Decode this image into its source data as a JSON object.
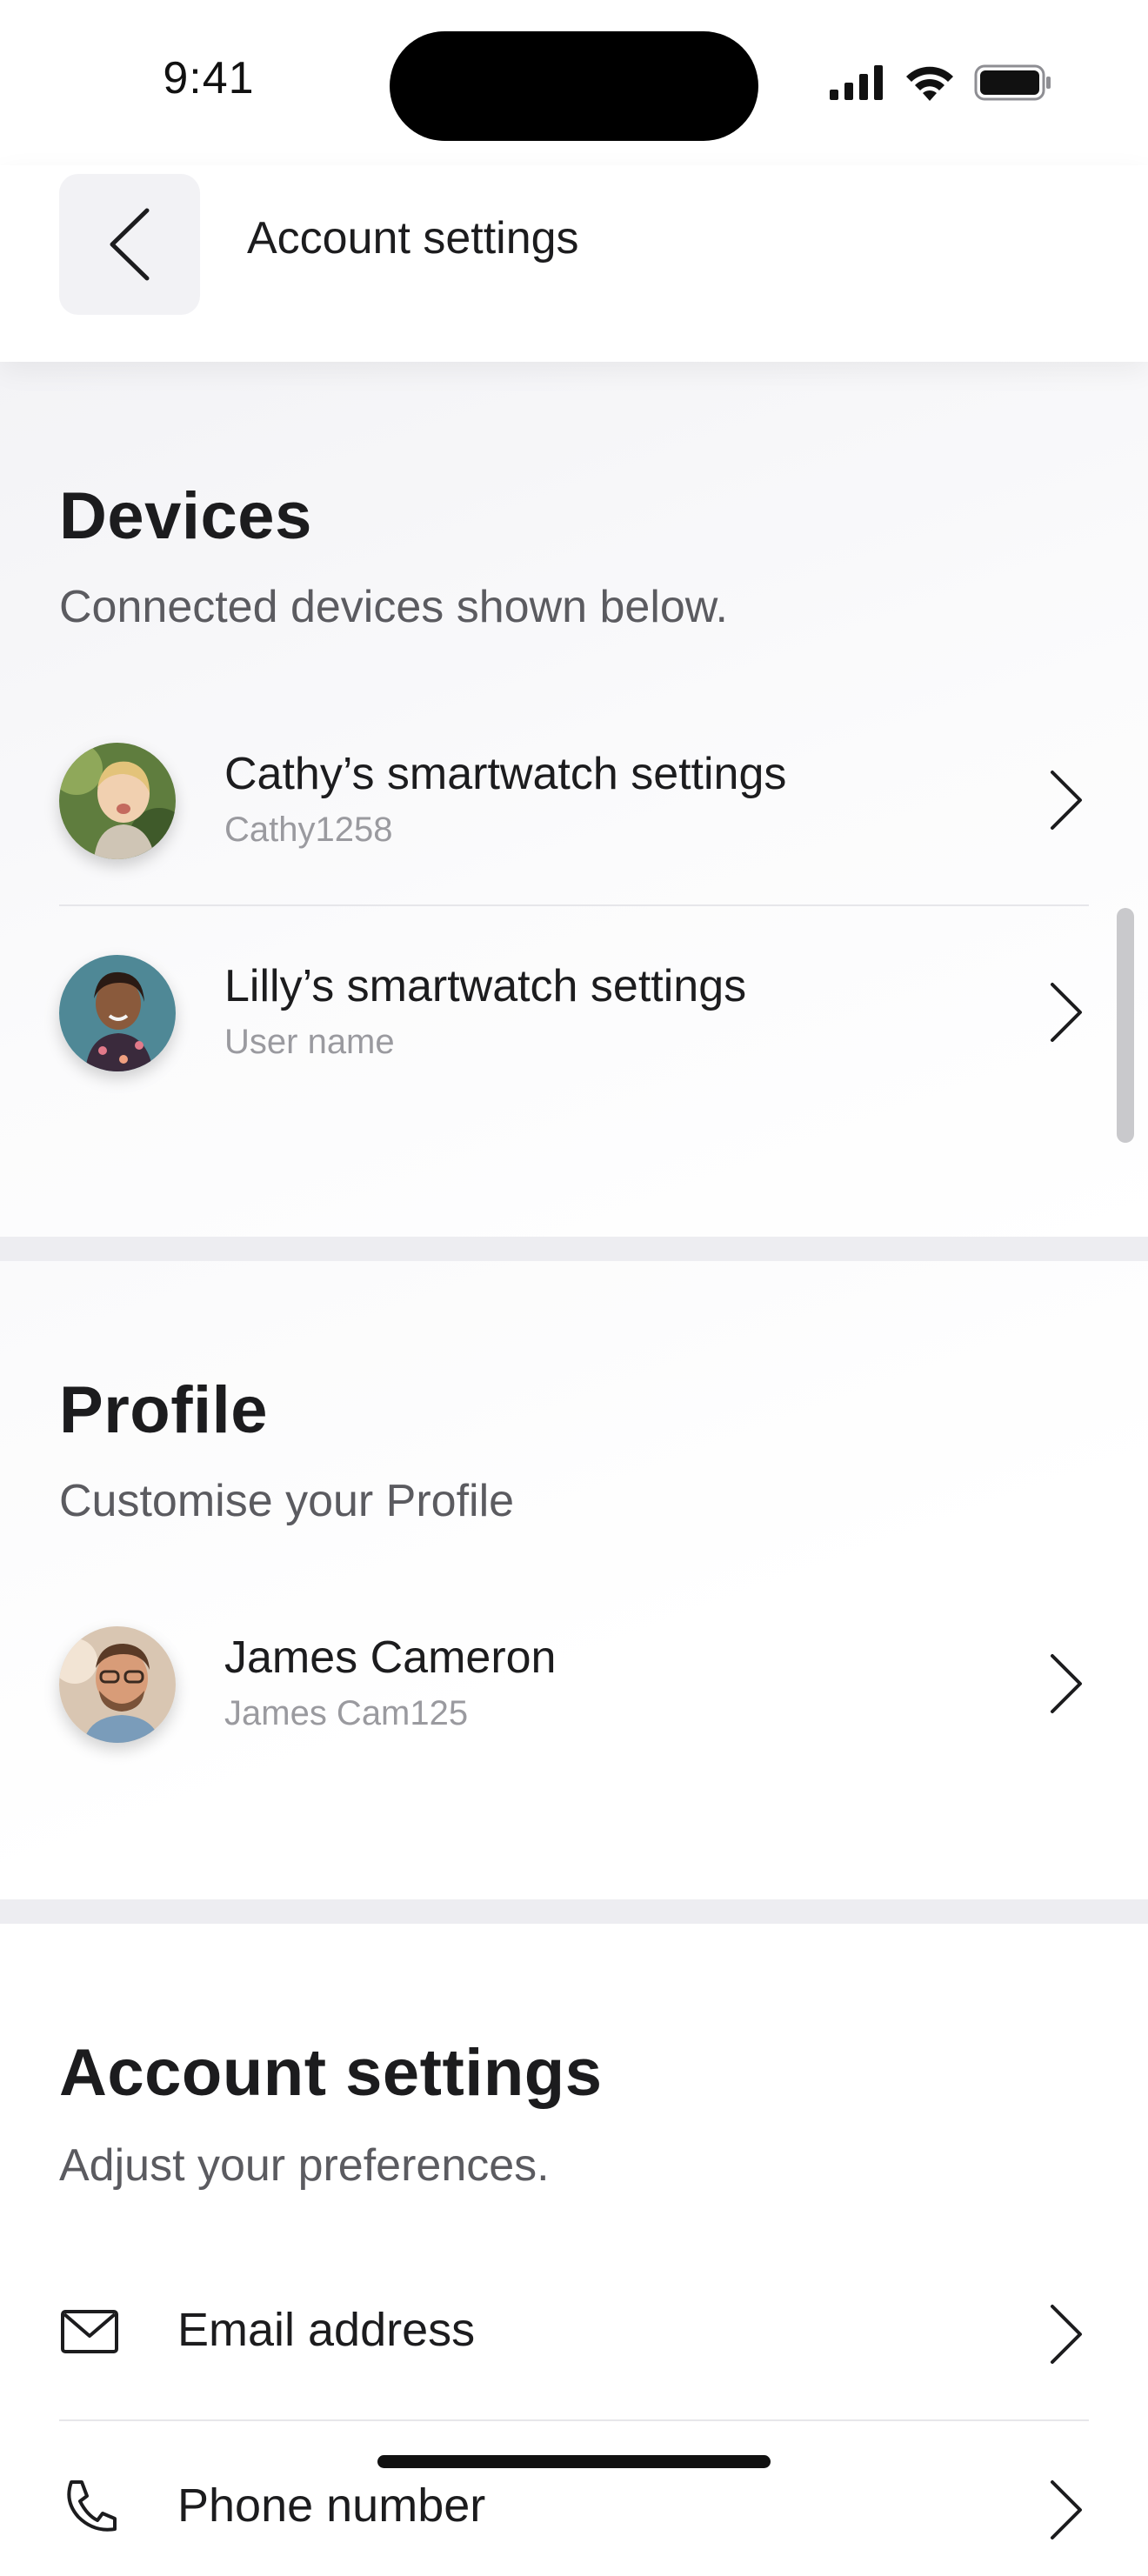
{
  "status_bar": {
    "time": "9:41"
  },
  "header": {
    "title": "Account settings"
  },
  "devices": {
    "heading": "Devices",
    "subtitle": "Connected devices shown below.",
    "items": [
      {
        "title": "Cathy’s smartwatch settings",
        "subtitle": "Cathy1258"
      },
      {
        "title": "Lilly’s smartwatch settings",
        "subtitle": "User name"
      }
    ]
  },
  "profile": {
    "heading": "Profile",
    "subtitle": "Customise your Profile",
    "items": [
      {
        "title": "James Cameron",
        "subtitle": "James Cam125"
      }
    ]
  },
  "account": {
    "heading": "Account settings",
    "subtitle": "Adjust your preferences.",
    "items": [
      {
        "label": "Email address",
        "icon": "mail-icon"
      },
      {
        "label": "Phone number",
        "icon": "phone-icon"
      }
    ]
  },
  "colors": {
    "text_primary": "#1c1c1e",
    "text_secondary": "#5b5b60",
    "text_muted": "#9a9a9f",
    "band": "#ededf1"
  }
}
